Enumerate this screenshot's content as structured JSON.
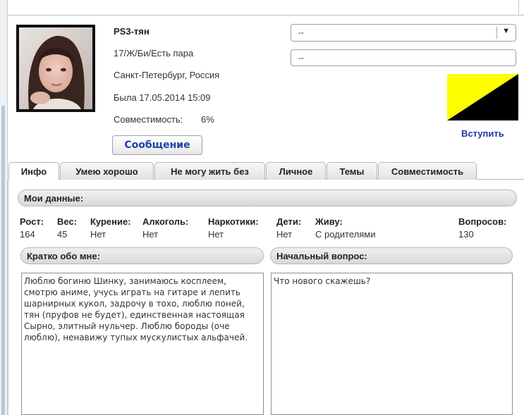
{
  "profile": {
    "name": "PS3-тян",
    "details": "17/Ж/Би/Есть пара",
    "location": "Санкт-Петербург, Россия",
    "last_seen": "Была 17.05.2014 15:09",
    "compat_label": "Совместимость:",
    "compat_value": "6%",
    "message_button": "Сообщение"
  },
  "side": {
    "select_value": "--",
    "input_value": "--",
    "join_label": "Вступить",
    "flag_colors": [
      "#ffff00",
      "#000000"
    ]
  },
  "tabs": [
    {
      "label": "Инфо",
      "active": true
    },
    {
      "label": "Умею хорошо",
      "active": false
    },
    {
      "label": "Не могу жить без",
      "active": false
    },
    {
      "label": "Личное",
      "active": false
    },
    {
      "label": "Темы",
      "active": false
    },
    {
      "label": "Совместимость",
      "active": false
    }
  ],
  "my_data": {
    "title": "Мои данные:",
    "stats": [
      {
        "label": "Рост:",
        "value": "164"
      },
      {
        "label": "Вес:",
        "value": "45"
      },
      {
        "label": "Курение:",
        "value": "Нет"
      },
      {
        "label": "Алкоголь:",
        "value": "Нет"
      },
      {
        "label": "Наркотики:",
        "value": "Нет"
      },
      {
        "label": "Дети:",
        "value": "Нет"
      },
      {
        "label": "Живу:",
        "value": "С родителями"
      },
      {
        "label": "Вопросов:",
        "value": "130"
      }
    ]
  },
  "about": {
    "title": "Кратко обо мне:",
    "text": "Люблю богиню Шинку, занимаюсь косплеем, смотрю аниме, учусь играть на гитаре и лепить шарнирных кукол, задрочу в тохо, люблю поней, тян (пруфов не будет), единственная настоящая Сырно, элитный нульчер. Люблю бороды (оче люблю), ненавижу тупых мускулистых альфачей."
  },
  "question": {
    "title": "Начальный вопрос:",
    "text": "Что нового скажешь?"
  }
}
